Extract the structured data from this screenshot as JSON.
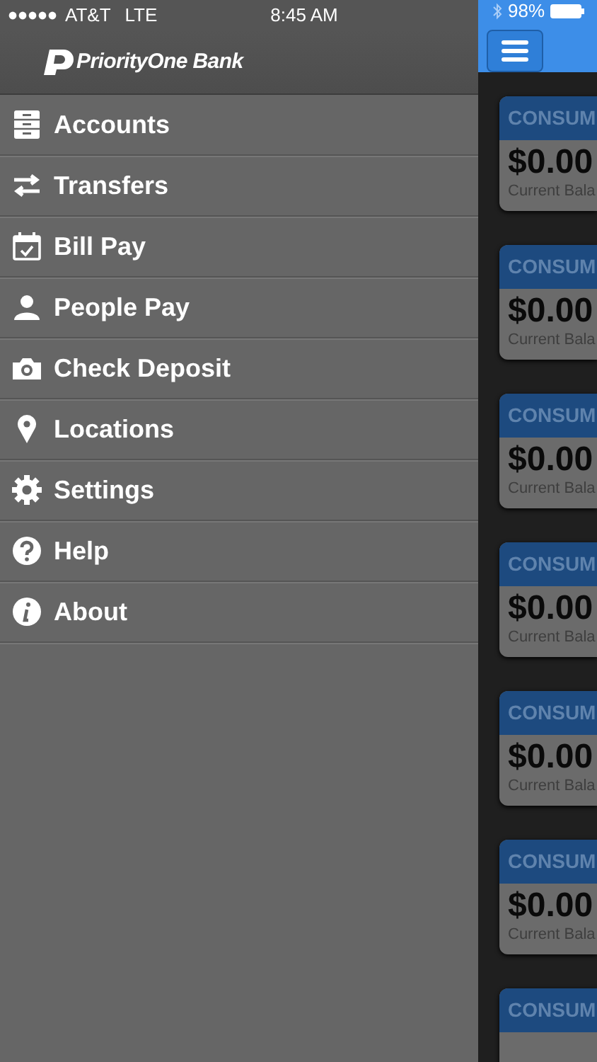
{
  "status_bar": {
    "carrier": "AT&T",
    "network": "LTE",
    "time": "8:45 AM",
    "battery": "98%"
  },
  "header": {
    "brand": "PriorityOne Bank"
  },
  "menu": [
    {
      "label": "Accounts",
      "kind": "accounts"
    },
    {
      "label": "Transfers",
      "kind": "transfers"
    },
    {
      "label": "Bill Pay",
      "kind": "billpay"
    },
    {
      "label": "People Pay",
      "kind": "person"
    },
    {
      "label": "Check Deposit",
      "kind": "camera"
    },
    {
      "label": "Locations",
      "kind": "location"
    },
    {
      "label": "Settings",
      "kind": "settings"
    },
    {
      "label": "Help",
      "kind": "help"
    },
    {
      "label": "About",
      "kind": "about"
    }
  ],
  "accounts": [
    {
      "title": "CONSUM",
      "amount": "$0.00",
      "caption": "Current Bala"
    },
    {
      "title": "CONSUM",
      "amount": "$0.00",
      "caption": "Current Bala"
    },
    {
      "title": "CONSUM",
      "amount": "$0.00",
      "caption": "Current Bala"
    },
    {
      "title": "CONSUM",
      "amount": "$0.00",
      "caption": "Current Bala"
    },
    {
      "title": "CONSUM",
      "amount": "$0.00",
      "caption": "Current Bala"
    },
    {
      "title": "CONSUM",
      "amount": "$0.00",
      "caption": "Current Bala"
    },
    {
      "title": "CONSUM"
    }
  ]
}
